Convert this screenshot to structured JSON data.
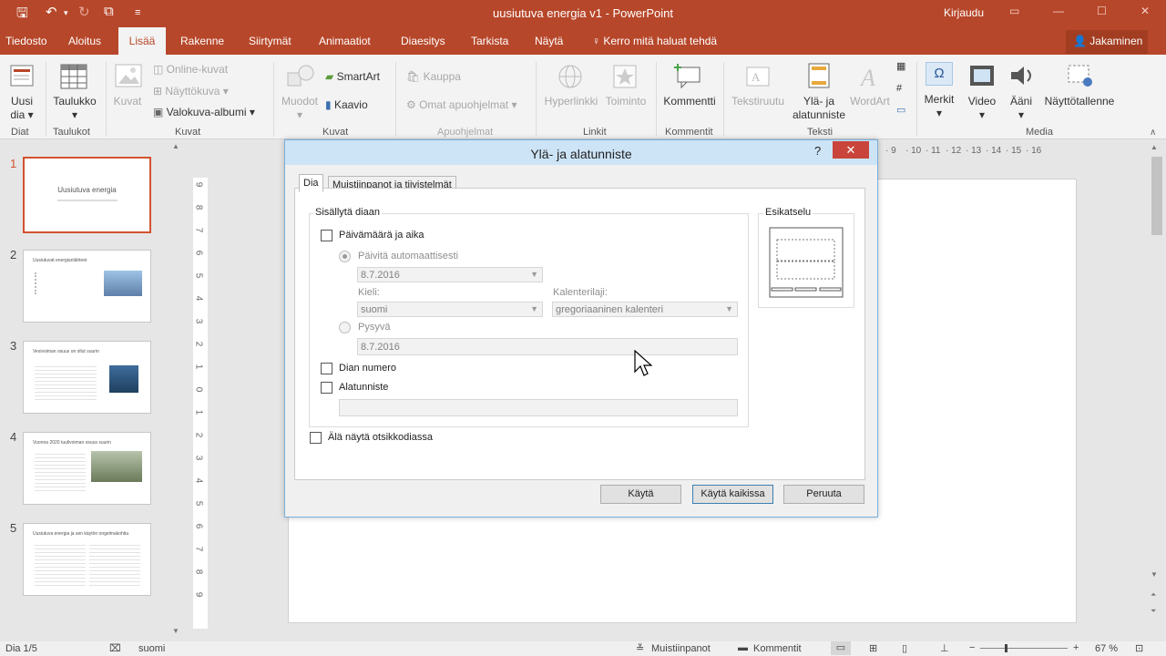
{
  "window": {
    "title": "uusiutuva energia v1 - PowerPoint",
    "signin": "Kirjaudu",
    "share": "Jakaminen"
  },
  "tabs": [
    "Tiedosto",
    "Aloitus",
    "Lisää",
    "Rakenne",
    "Siirtymät",
    "Animaatiot",
    "Diaesitys",
    "Tarkista",
    "Näytä"
  ],
  "active_tab": "Lisää",
  "tell_me": "Kerro mitä haluat tehdä",
  "ribbon": {
    "new_slide": "Uusi",
    "new_slide2": "dia",
    "table": "Taulukko",
    "images": "Kuvat",
    "online_images": "Online-kuvat",
    "screenshot": "Näyttökuva",
    "photo_album": "Valokuva-albumi",
    "shapes": "Muodot",
    "smartart": "SmartArt",
    "chart": "Kaavio",
    "store": "Kauppa",
    "my_addins": "Omat apuohjelmat",
    "hyperlink": "Hyperlinkki",
    "action": "Toiminto",
    "comment": "Kommentti",
    "textbox": "Tekstiruutu",
    "header_footer": "Ylä- ja",
    "header_footer2": "alatunniste",
    "wordart": "WordArt",
    "symbols": "Merkit",
    "video": "Video",
    "audio": "Ääni",
    "screen_recording": "Näyttötallenne",
    "groups": {
      "slides": "Diat",
      "tables": "Taulukot",
      "images": "Kuvat",
      "illustrations": "Kuvat",
      "addins": "Apuohjelmat",
      "links": "Linkit",
      "comments": "Kommentit",
      "text": "Teksti",
      "media": "Media"
    }
  },
  "slides": [
    {
      "num": "1",
      "title": "Uusiutuva energia"
    },
    {
      "num": "2",
      "title": "Uusiutuvat energianlähteet"
    },
    {
      "num": "3",
      "title": "Vesivoiman osuus on ollut suurin"
    },
    {
      "num": "4",
      "title": "Vuonna 2020 tuulivoiman osuus suurin"
    },
    {
      "num": "5",
      "title": "Uusiutuva energia ja sen käytön ongelmakohtia"
    }
  ],
  "ruler": {
    "top_ticks": [
      "9",
      "10",
      "11",
      "12",
      "13",
      "14",
      "15",
      "16"
    ],
    "left_ticks": [
      "9",
      "8",
      "7",
      "6",
      "5",
      "4",
      "3",
      "2",
      "1",
      "0",
      "1",
      "2",
      "3",
      "4",
      "5",
      "6",
      "7",
      "8",
      "9"
    ]
  },
  "status": {
    "slide_of": "Dia 1/5",
    "language": "suomi",
    "notes": "Muistiinpanot",
    "comments": "Kommentit",
    "zoom": "67 %"
  },
  "dialog": {
    "title": "Ylä- ja alatunniste",
    "help": "?",
    "close": "✕",
    "tab_slide": "Dia",
    "tab_notes": "Muistiinpanot ja tiivistelmät",
    "include_legend": "Sisällytä diaan",
    "date_time": "Päivämäärä ja aika",
    "update_auto": "Päivitä automaattisesti",
    "date_value": "8.7.2016",
    "language_label": "Kieli:",
    "language_value": "suomi",
    "calendar_label": "Kalenterilaji:",
    "calendar_value": "gregoriaaninen kalenteri",
    "fixed": "Pysyvä",
    "fixed_value": "8.7.2016",
    "slide_number": "Dian numero",
    "footer": "Alatunniste",
    "footer_value": "",
    "dont_show_title": "Älä näytä otsikkodiassa",
    "preview_legend": "Esikatselu",
    "apply": "Käytä",
    "apply_all": "Käytä kaikissa",
    "cancel": "Peruuta"
  },
  "colors": {
    "accent": "#b7472a",
    "dialog_title": "#cde4f7",
    "close": "#c9443a",
    "thumb_selected": "#d35230"
  }
}
